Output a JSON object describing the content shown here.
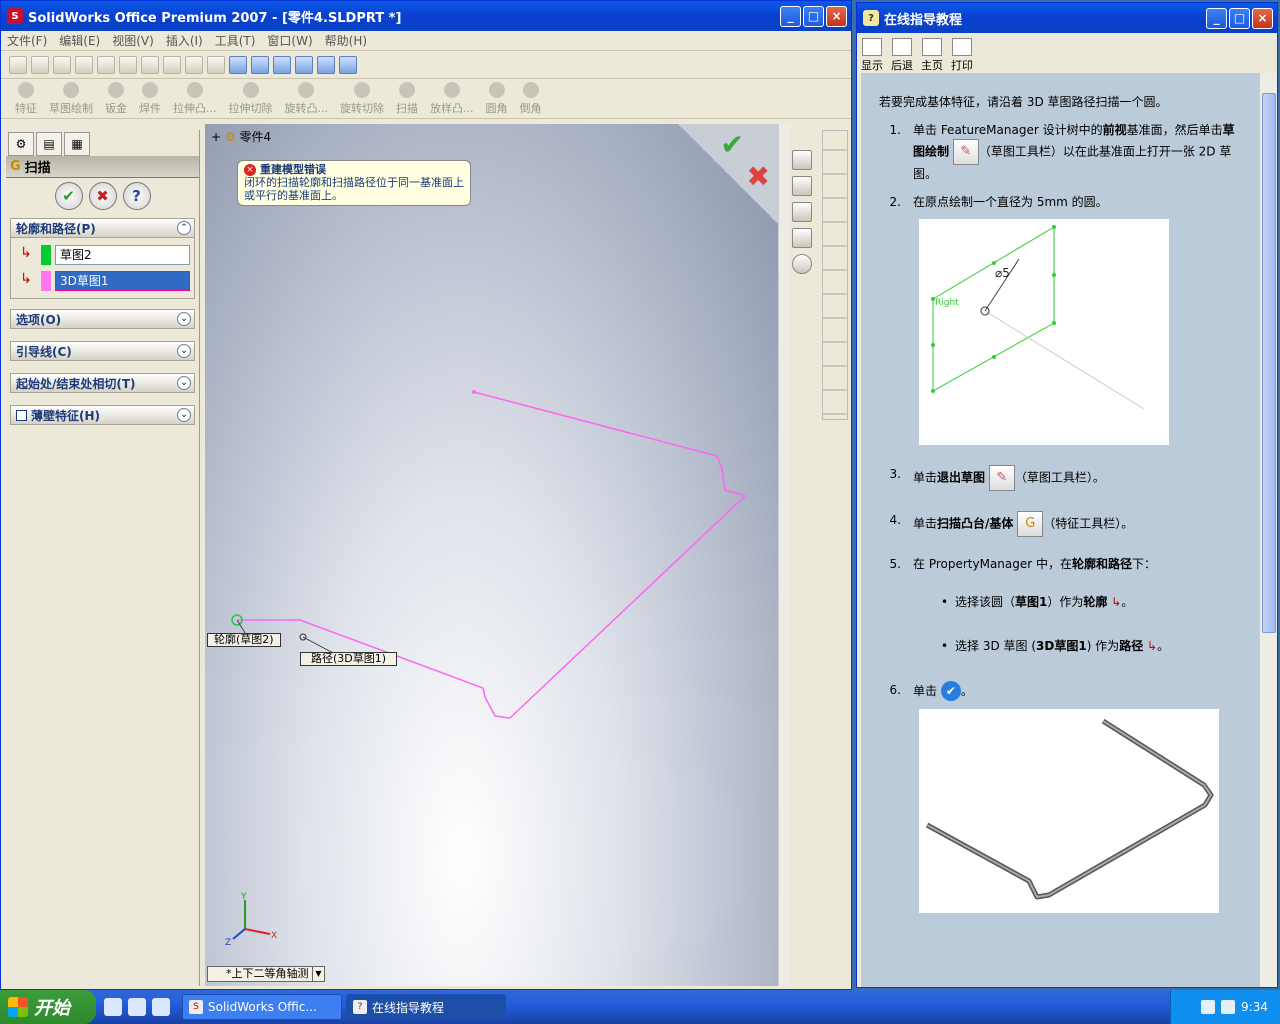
{
  "sw": {
    "title": "SolidWorks Office Premium 2007 - [零件4.SLDPRT *]",
    "menu": [
      "文件(F)",
      "编辑(E)",
      "视图(V)",
      "插入(I)",
      "工具(T)",
      "窗口(W)",
      "帮助(H)"
    ],
    "features": [
      "特征",
      "草图绘制",
      "钣金",
      "焊件",
      "拉伸凸...",
      "拉伸切除",
      "旋转凸...",
      "旋转切除",
      "扫描",
      "放样凸...",
      "圆角",
      "倒角"
    ],
    "tree_root": "零件4",
    "view_name": "*上下二等角轴测"
  },
  "pm": {
    "title": "扫描",
    "ok": "✔",
    "cancel": "✖",
    "help": "?",
    "sections": {
      "profile_path": "轮廓和路径(P)",
      "options": "选项(O)",
      "guides": "引导线(C)",
      "tangency": "起始处/结束处相切(T)",
      "thin": "薄壁特征(H)"
    },
    "profile_value": "草图2",
    "path_value": "3D草图1"
  },
  "error": {
    "title": "重建模型错误",
    "message": "闭环的扫描轮廓和扫描路径位于同一基准面上或平行的基准面上。"
  },
  "labels": {
    "profile": "轮廓(草图2)",
    "path": "路径(3D草图1)"
  },
  "axes": {
    "x": "X",
    "y": "Y",
    "z": "Z"
  },
  "help": {
    "title": "在线指导教程",
    "toolbar": [
      "显示",
      "后退",
      "主页",
      "打印"
    ],
    "intro": "若要完成基体特征，请沿着 3D 草图路径扫描一个圆。",
    "steps": {
      "s1_a": "单击 FeatureManager 设计树中的",
      "s1_b": "前视",
      "s1_c": "基准面，然后单击",
      "s1_d": "草图绘制",
      "s1_e": "（草图工具栏）以在此基准面上打开一张 2D 草图。",
      "s2": "在原点绘制一个直径为 5mm 的圆。",
      "fig_label": "Right",
      "fig_dim": "⌀5",
      "s3_a": "单击",
      "s3_b": "退出草图",
      "s3_c": "（草图工具栏）。",
      "s4_a": "单击",
      "s4_b": "扫描凸台/基体",
      "s4_c": "（特征工具栏）。",
      "s5_a": "在 PropertyManager 中，在",
      "s5_b": "轮廓和路径",
      "s5_c": "下：",
      "b1_a": "选择该圆（",
      "b1_b": "草图1",
      "b1_c": "）作为",
      "b1_d": "轮廓",
      "b1_e": "。",
      "b2_a": "选择 3D 草图 (",
      "b2_b": "3D草图1",
      "b2_c": ") 作为",
      "b2_d": "路径",
      "b2_e": "。",
      "s6": "单击",
      "s6_end": "。"
    },
    "nums": [
      "1.",
      "2.",
      "3.",
      "4.",
      "5.",
      "6."
    ]
  },
  "taskbar": {
    "start": "开始",
    "tasks": [
      "SolidWorks Offic...",
      "在线指导教程"
    ],
    "clock": "9:34"
  }
}
